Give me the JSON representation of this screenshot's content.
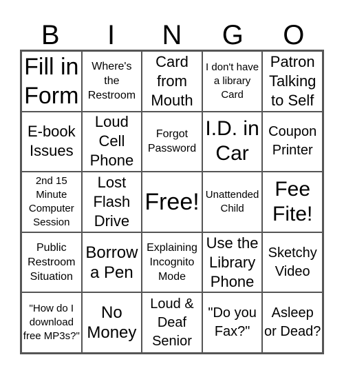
{
  "header": {
    "letters": [
      "B",
      "I",
      "N",
      "G",
      "O"
    ]
  },
  "cells": [
    "Fill in Form",
    "Where's the Restroom",
    "Card from Mouth",
    "I don't have a library Card",
    "Patron Talking to Self",
    "E-book Issues",
    "Loud Cell Phone",
    "Forgot Password",
    "I.D. in Car",
    "Coupon Printer",
    "2nd 15 Minute Computer Session",
    "Lost Flash Drive",
    "Free!",
    "Unattended Child",
    "Fee Fite!",
    "Public Restroom Situation",
    "Borrow a Pen",
    "Explaining Incognito Mode",
    "Use the Library Phone",
    "Sketchy Video",
    "\"How do I download free MP3s?\"",
    "No Money",
    "Loud & Deaf Senior",
    "\"Do you Fax?\"",
    "Asleep or Dead?"
  ]
}
